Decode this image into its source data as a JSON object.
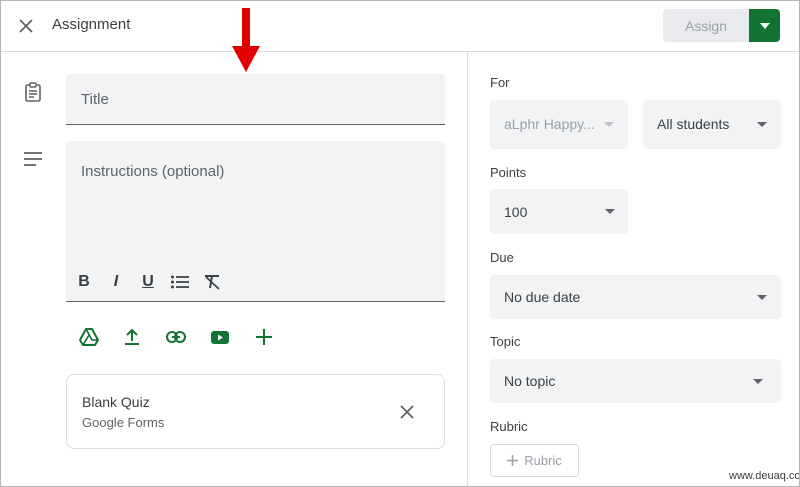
{
  "header": {
    "title": "Assignment",
    "assign_label": "Assign",
    "close_icon": "close-icon",
    "accent_color": "#137333"
  },
  "form": {
    "title_placeholder": "Title",
    "instructions_placeholder": "Instructions (optional)",
    "format_tools": [
      "B",
      "I",
      "U",
      "bulleted-list",
      "clear-formatting"
    ]
  },
  "attachments": {
    "icons": [
      "google-drive-icon",
      "upload-icon",
      "link-icon",
      "youtube-icon",
      "add-icon"
    ]
  },
  "attached_item": {
    "name": "Blank Quiz",
    "type": "Google Forms"
  },
  "settings": {
    "for_label": "For",
    "class_value": "aLphr Happy...",
    "students_value": "All students",
    "points_label": "Points",
    "points_value": "100",
    "due_label": "Due",
    "due_value": "No due date",
    "topic_label": "Topic",
    "topic_value": "No topic",
    "rubric_label": "Rubric",
    "rubric_button": "Rubric"
  },
  "watermark": "www.deuaq.com"
}
